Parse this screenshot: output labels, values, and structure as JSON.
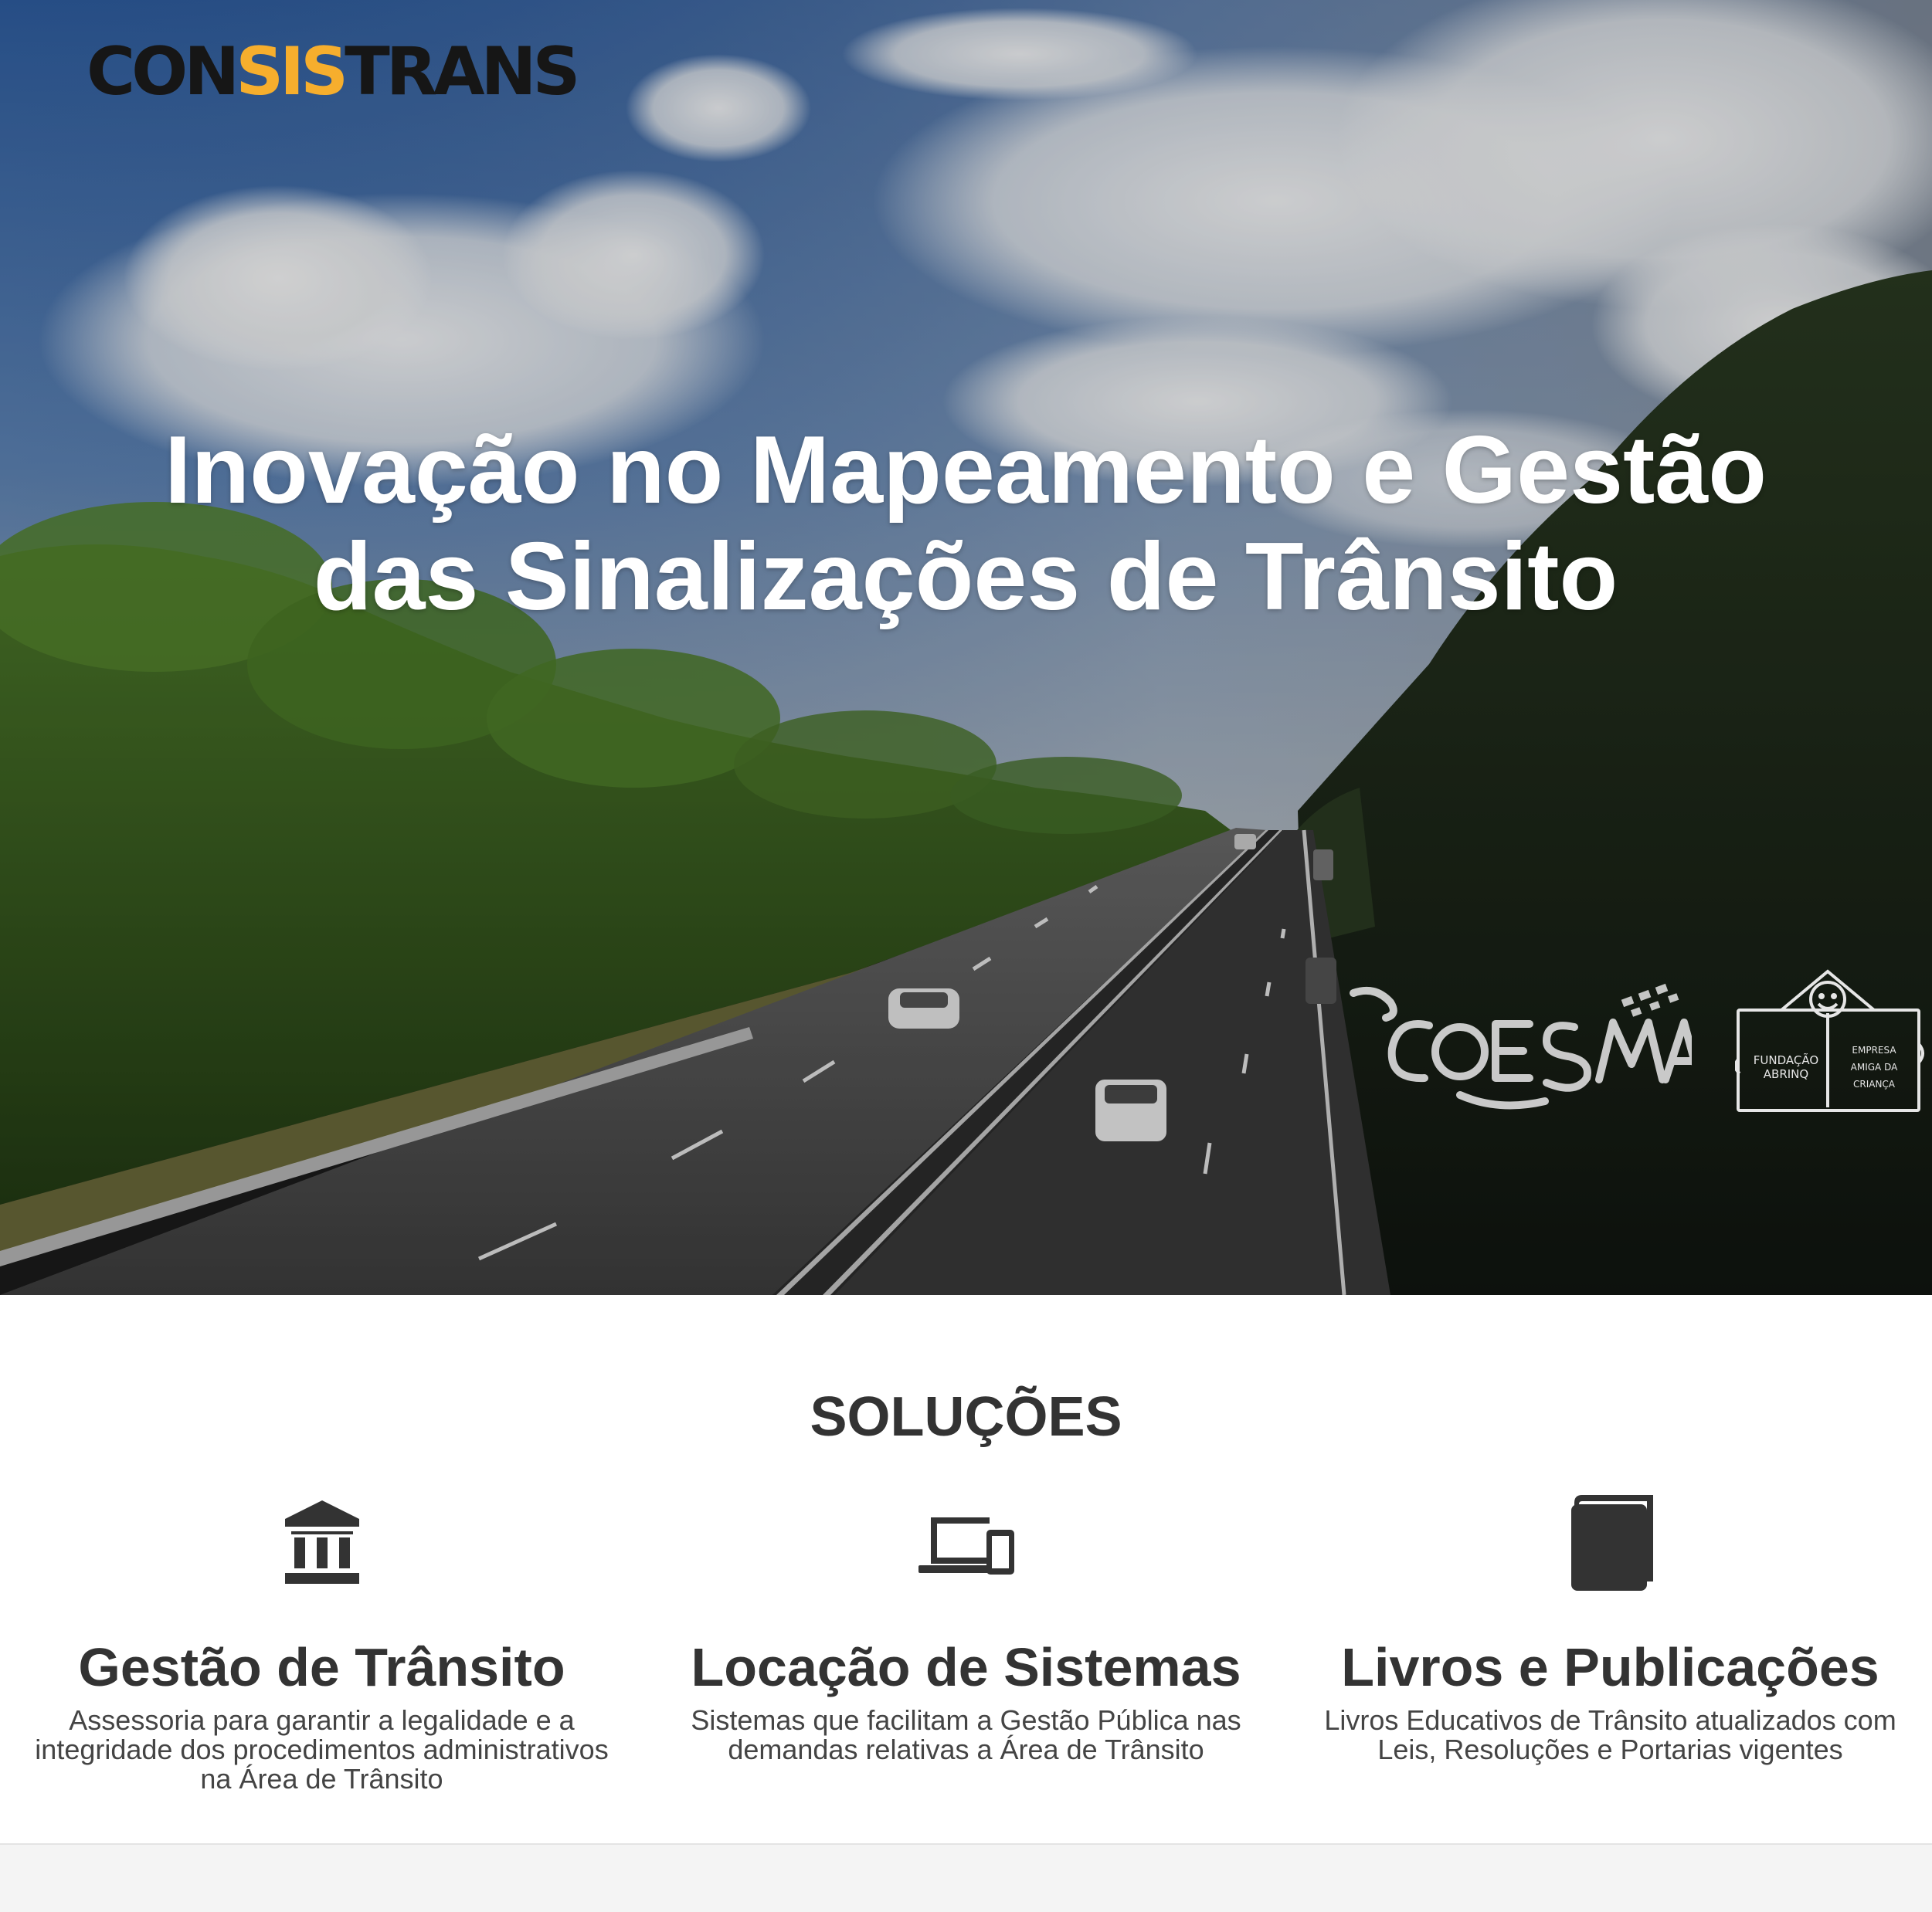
{
  "brand": {
    "logo_prefix": "CON",
    "logo_accent": "SIS",
    "logo_suffix": "TRANS",
    "accent_color": "#f6ae2d"
  },
  "hero": {
    "headline_line1": "Inovação no Mapeamento e Gestão",
    "headline_line2": "das Sinalizações de Trânsito",
    "partners": [
      {
        "name": "COESMA"
      },
      {
        "name": "Fundação Abrinq - Empresa Amiga da Criança",
        "left_text_1": "FUNDAÇÃO",
        "left_text_2": "ABRINQ",
        "right_text_1": "EMPRESA",
        "right_text_2": "AMIGA DA",
        "right_text_3": "CRIANÇA"
      }
    ]
  },
  "solutions": {
    "title": "SOLUÇÕES",
    "items": [
      {
        "icon": "bank-icon",
        "heading": "Gestão de Trânsito",
        "description": "Assessoria para garantir a legalidade e a integridade dos procedimentos administrativos na Área de Trânsito"
      },
      {
        "icon": "devices-icon",
        "heading": "Locação de Sistemas",
        "description": "Sistemas que facilitam a Gestão Pública nas demandas relativas a Área de Trânsito"
      },
      {
        "icon": "book-icon",
        "heading": "Livros e Publicações",
        "description": "Livros Educativos de Trânsito atualizados com Leis, Resoluções e Portarias vigentes"
      }
    ]
  }
}
